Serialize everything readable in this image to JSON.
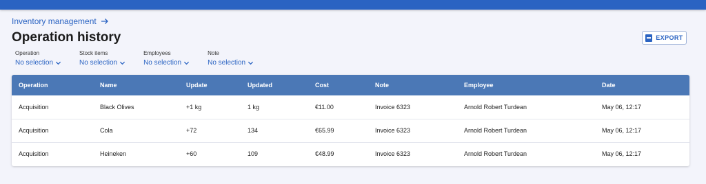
{
  "breadcrumb": {
    "label": "Inventory management"
  },
  "page": {
    "title": "Operation history"
  },
  "toolbar": {
    "export_label": "EXPORT"
  },
  "filters": [
    {
      "label": "Operation",
      "value": "No selection"
    },
    {
      "label": "Stock items",
      "value": "No selection"
    },
    {
      "label": "Employees",
      "value": "No selection"
    },
    {
      "label": "Note",
      "value": "No selection"
    }
  ],
  "table": {
    "headers": [
      "Operation",
      "Name",
      "Update",
      "Updated",
      "Cost",
      "Note",
      "Employee",
      "Date"
    ],
    "rows": [
      [
        "Acquisition",
        "Black Olives",
        "+1 kg",
        "1 kg",
        "€11.00",
        "Invoice 6323",
        "Arnold Robert Turdean",
        "May 06, 12:17"
      ],
      [
        "Acquisition",
        "Cola",
        "+72",
        "134",
        "€65.99",
        "Invoice 6323",
        "Arnold Robert Turdean",
        "May 06, 12:17"
      ],
      [
        "Acquisition",
        "Heineken",
        "+60",
        "109",
        "€48.99",
        "Invoice 6323",
        "Arnold Robert Turdean",
        "May 06, 12:17"
      ]
    ]
  },
  "colors": {
    "accent": "#2a63c2",
    "header_bg": "#4b78b6",
    "page_bg": "#f3f4fb"
  },
  "icons": {
    "breadcrumb": "arrow-right-icon",
    "filter": "chevron-down-icon",
    "export": "pdf-icon"
  }
}
